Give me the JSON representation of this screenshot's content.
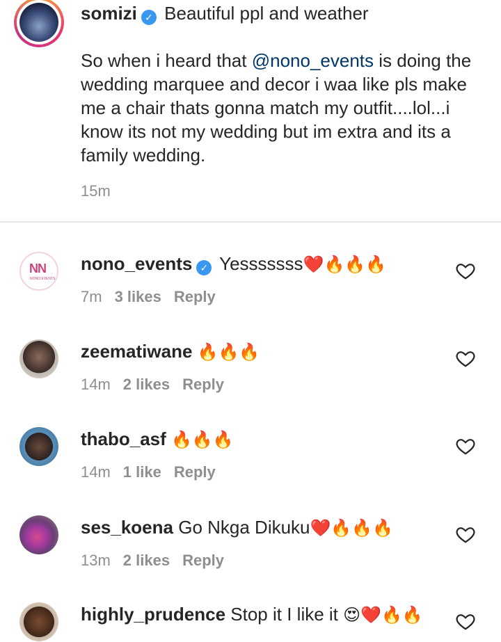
{
  "caption": {
    "username": "somizi",
    "verified_icon": "verified-badge-icon",
    "title_text": "Beautiful ppl and weather",
    "body_before": "So when i heard that ",
    "mention": "@nono_events",
    "body_after": " is doing the wedding marquee and decor i waa like pls make me a chair thats gonna match my outfit....lol...i know its not my wedding but im extra and its a family wedding.",
    "time": "15m"
  },
  "comments": [
    {
      "username": "nono_events",
      "verified": true,
      "text": "Yesssssss",
      "emojis": "❤️🔥🔥🔥",
      "time": "7m",
      "likes": "3 likes",
      "reply": "Reply",
      "avatar_logo": "NN",
      "avatar_sub": "NONO EVENTS"
    },
    {
      "username": "zeematiwane",
      "verified": false,
      "text": "",
      "emojis": "🔥🔥🔥",
      "time": "14m",
      "likes": "2 likes",
      "reply": "Reply"
    },
    {
      "username": "thabo_asf",
      "verified": false,
      "text": "",
      "emojis": "🔥🔥🔥",
      "time": "14m",
      "likes": "1 like",
      "reply": "Reply"
    },
    {
      "username": "ses_koena",
      "verified": false,
      "text": "Go Nkga Dikuku",
      "emojis": "❤️🔥🔥🔥",
      "time": "13m",
      "likes": "2 likes",
      "reply": "Reply"
    },
    {
      "username": "highly_prudence",
      "verified": false,
      "text": "Stop it I like it",
      "emojis": "😍❤️🔥🔥",
      "time": "",
      "likes": "",
      "reply": ""
    }
  ],
  "icons": {
    "like": "heart-outline-icon",
    "verified": "verified-badge-icon"
  },
  "colors": {
    "verified": "#3897f0",
    "mention": "#00376b",
    "meta": "#8e8e8e",
    "fire": "#f05a1e",
    "heart": "#e0102a"
  }
}
